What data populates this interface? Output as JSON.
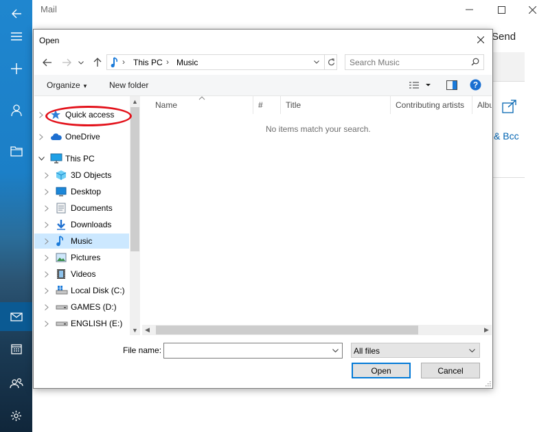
{
  "app": {
    "title": "Mail",
    "send_label": "Send",
    "bcc_label": "& Bcc",
    "window_controls": [
      "minimize-icon",
      "maximize-icon",
      "close-icon"
    ],
    "rail_icons": [
      "back-arrow-icon",
      "hamburger-menu-icon",
      "plus-icon",
      "person-icon",
      "folder-icon",
      "mail-icon",
      "calendar-icon",
      "people-icon",
      "gear-icon"
    ]
  },
  "dialog": {
    "title": "Open",
    "address": {
      "segments": [
        "This PC",
        "Music"
      ],
      "icon": "music-note-icon"
    },
    "search": {
      "placeholder": "Search Music"
    },
    "toolbar": {
      "organize": "Organize",
      "new_folder": "New folder"
    },
    "nav_items": [
      {
        "label": "Quick access",
        "icon": "star-icon",
        "level": 0,
        "expanded": false,
        "selected": false
      },
      {
        "label": "OneDrive",
        "icon": "cloud-icon",
        "level": 0,
        "expanded": false,
        "selected": false
      },
      {
        "label": "This PC",
        "icon": "monitor-icon",
        "level": 0,
        "expanded": true,
        "selected": false
      },
      {
        "label": "3D Objects",
        "icon": "cube-icon",
        "level": 1,
        "expanded": false,
        "selected": false
      },
      {
        "label": "Desktop",
        "icon": "desktop-icon",
        "level": 1,
        "expanded": false,
        "selected": false
      },
      {
        "label": "Documents",
        "icon": "documents-icon",
        "level": 1,
        "expanded": false,
        "selected": false
      },
      {
        "label": "Downloads",
        "icon": "download-arrow-icon",
        "level": 1,
        "expanded": false,
        "selected": false
      },
      {
        "label": "Music",
        "icon": "music-note-icon",
        "level": 1,
        "expanded": false,
        "selected": true
      },
      {
        "label": "Pictures",
        "icon": "pictures-icon",
        "level": 1,
        "expanded": false,
        "selected": false
      },
      {
        "label": "Videos",
        "icon": "film-icon",
        "level": 1,
        "expanded": false,
        "selected": false
      },
      {
        "label": "Local Disk (C:)",
        "icon": "windows-drive-icon",
        "level": 1,
        "expanded": false,
        "selected": false
      },
      {
        "label": "GAMES (D:)",
        "icon": "drive-icon",
        "level": 1,
        "expanded": false,
        "selected": false
      },
      {
        "label": "ENGLISH (E:)",
        "icon": "drive-icon",
        "level": 1,
        "expanded": false,
        "selected": false
      }
    ],
    "columns": [
      "Name",
      "#",
      "Title",
      "Contributing artists",
      "Album"
    ],
    "empty_message": "No items match your search.",
    "file_name_label": "File name:",
    "file_name_value": "",
    "filter_value": "All files",
    "open_label": "Open",
    "cancel_label": "Cancel"
  },
  "annotation": {
    "color": "#e3121b",
    "target": "Quick access"
  },
  "colors": {
    "accent": "#0078d7",
    "selection": "#cce8ff",
    "rail": "#1f86cf"
  }
}
